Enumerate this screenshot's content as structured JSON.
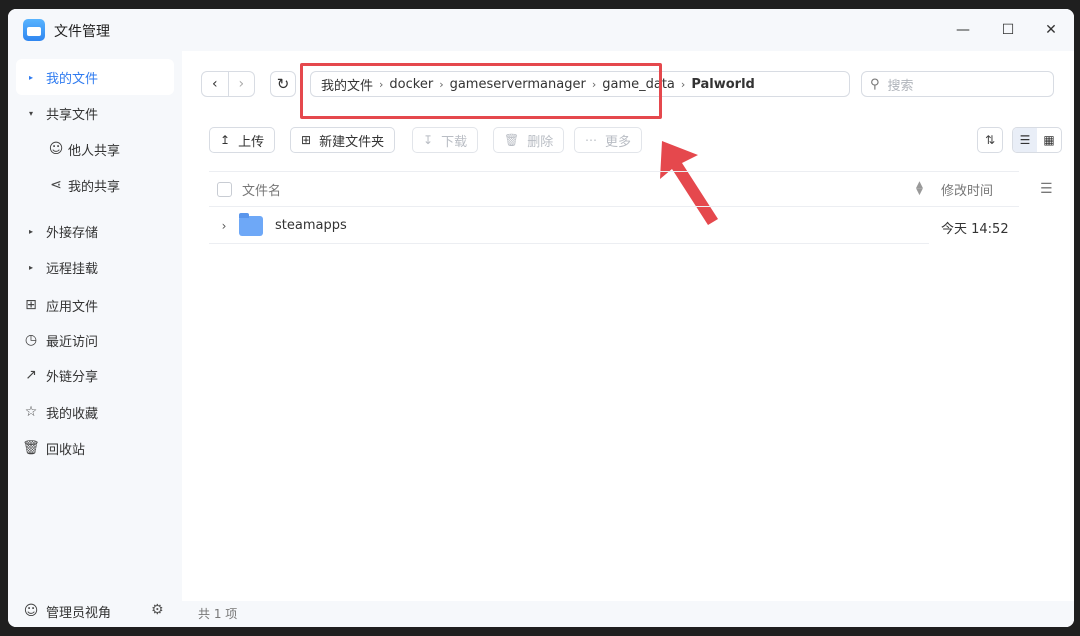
{
  "app": {
    "title": "文件管理"
  },
  "window_controls": {
    "minimize": "—",
    "maximize": "☐",
    "close": "✕"
  },
  "sidebar": {
    "items": [
      {
        "label": "我的文件",
        "arrow": "▸",
        "active": true
      },
      {
        "label": "共享文件",
        "arrow": "▾"
      },
      {
        "label": "他人共享",
        "icon": "user-icon"
      },
      {
        "label": "我的共享",
        "icon": "share-icon"
      },
      {
        "label": "外接存储",
        "arrow": "▸"
      },
      {
        "label": "远程挂载",
        "arrow": "▸"
      },
      {
        "label": "应用文件",
        "icon": "apps-icon"
      },
      {
        "label": "最近访问",
        "icon": "clock-icon"
      },
      {
        "label": "外链分享",
        "icon": "external-link-icon"
      },
      {
        "label": "我的收藏",
        "icon": "star-icon"
      },
      {
        "label": "回收站",
        "icon": "trash-icon"
      }
    ],
    "admin_view": "管理员视角"
  },
  "breadcrumb": [
    "我的文件",
    "docker",
    "gameservermanager",
    "game_data",
    "Palworld"
  ],
  "search": {
    "placeholder": "搜索"
  },
  "toolbar": {
    "upload": "上传",
    "new_folder": "新建文件夹",
    "download": "下载",
    "delete": "删除",
    "more": "更多"
  },
  "table": {
    "col_name": "文件名",
    "col_mtime": "修改时间",
    "rows": [
      {
        "name": "steamapps",
        "mtime": "今天 14:52"
      }
    ]
  },
  "status": {
    "count_text": "共 1 项"
  },
  "colors": {
    "accent": "#2f7bf0",
    "highlight": "#e5484d",
    "folder": "#6ea8f7"
  }
}
